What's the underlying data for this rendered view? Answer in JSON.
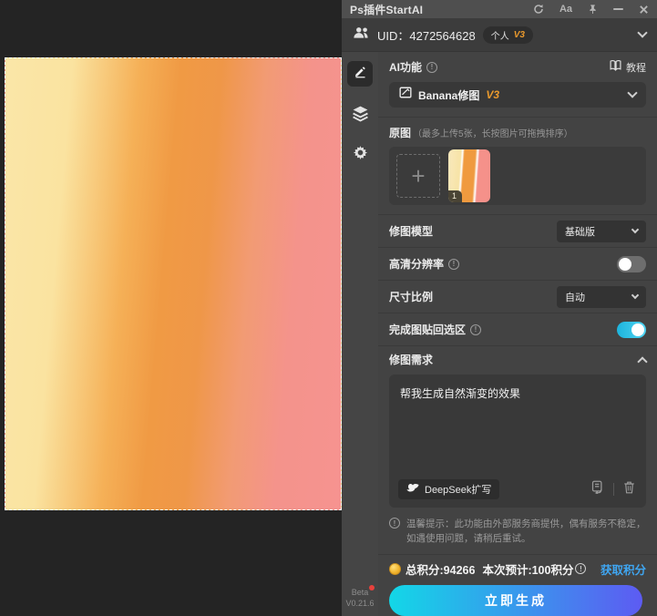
{
  "titlebar": {
    "title": "Ps插件StartAI",
    "aa": "Aa"
  },
  "uid": {
    "label": "UID：",
    "value": "4272564628",
    "plan": "个人",
    "plan_version": "V3"
  },
  "tools_rail": {
    "beta": "Beta",
    "version": "V0.21.6"
  },
  "ai": {
    "section_label": "AI功能",
    "tutorial_label": "教程",
    "feature_name": "Banana修图",
    "feature_version": "V3"
  },
  "upload": {
    "label": "原图",
    "hint": "（最多上传5张，长按图片可拖拽排序）",
    "plus": "+",
    "thumb_badge": "1"
  },
  "settings": {
    "model_label": "修图模型",
    "model_value": "基础版",
    "hd_label": "高清分辨率",
    "hd_state": "off",
    "ratio_label": "尺寸比例",
    "ratio_value": "自动",
    "paste_label": "完成图贴回选区",
    "paste_state": "on"
  },
  "prompt": {
    "header": "修图需求",
    "text": "帮我生成自然渐变的效果",
    "deepseek_label": "DeepSeek扩写"
  },
  "notice": {
    "text": "温馨提示：此功能由外部服务商提供，偶有服务不稳定，如遇使用问题，请稍后重试。"
  },
  "footer": {
    "total_points": "总积分:94266",
    "estimate": "本次预计:100积分",
    "get_points_label": "获取积分",
    "generate_label": "立即生成"
  },
  "canvas_image": {
    "gradient_colors": [
      "#fae3a0",
      "#f09a44",
      "#f4938b"
    ],
    "selection": "dashed marching-ants border"
  },
  "colors": {
    "accent_orange": "#eb9a2d",
    "link_blue": "#3fa6f2",
    "toggle_on": "#2cc3e8",
    "button_from": "#13d7e7",
    "button_to": "#5d5bf2"
  }
}
